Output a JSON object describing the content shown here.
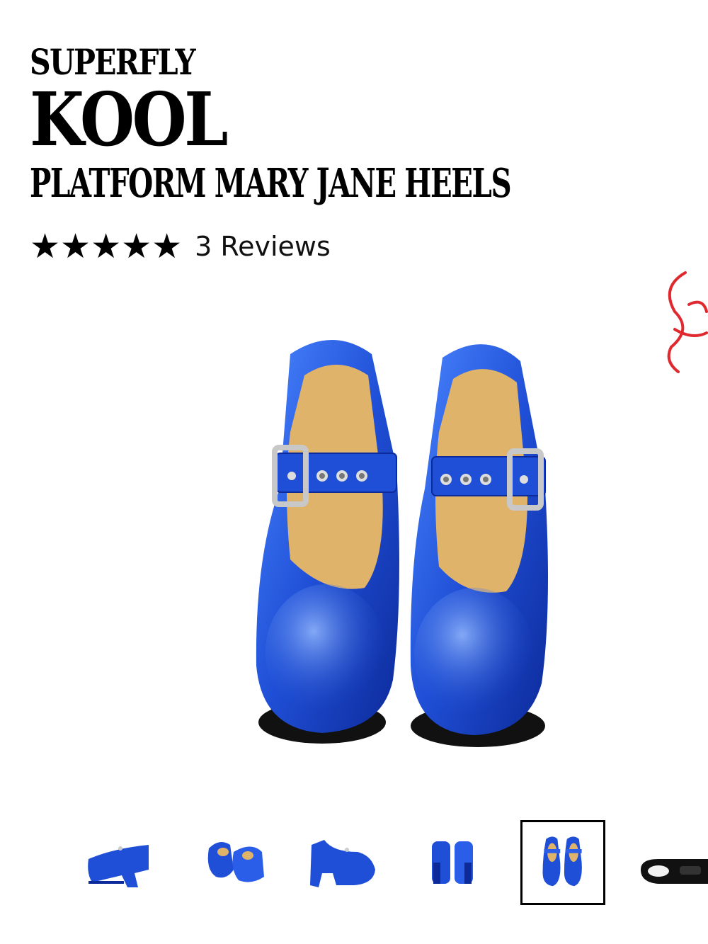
{
  "product": {
    "brand": "SUPERFLY",
    "name": "KOOL",
    "subtitle": "PLATFORM MARY JANE HEELS",
    "rating_stars": "★★★★★",
    "rating": 5,
    "reviews_label": "3 Reviews",
    "color": "#1f4fd6"
  },
  "gallery": {
    "thumbnail_count": 6,
    "selected_index": 4,
    "thumbnails": [
      {
        "view": "side"
      },
      {
        "view": "three-quarter pair"
      },
      {
        "view": "side"
      },
      {
        "view": "back pair"
      },
      {
        "view": "top pair"
      },
      {
        "view": "sole"
      }
    ]
  },
  "colors": {
    "shoe_blue": "#1f4fd6",
    "insole_tan": "#e0b36a",
    "peek_red": "#e0282f"
  }
}
